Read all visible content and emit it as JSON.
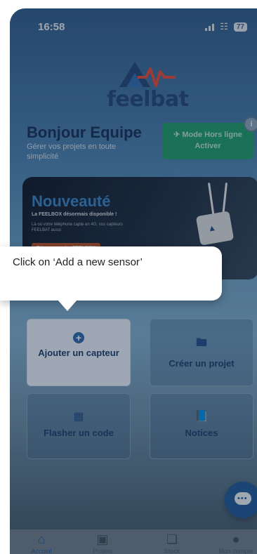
{
  "status_bar": {
    "time": "16:58",
    "battery": "77"
  },
  "logo": {
    "text": "feelbat"
  },
  "greeting": {
    "title": "Bonjour Equipe",
    "subtitle": "Gérer vos projets en toute simplicité"
  },
  "offline_button": {
    "line1": "Mode Hors ligne",
    "line2": "Activer",
    "info_icon": "i"
  },
  "banner": {
    "title": "Nouveauté",
    "line1": "La FEELBOX désormais disponible !",
    "line2": "Là où votre téléphone capte en 4G, vos capteurs FEELBAT aussi",
    "button": "Réserver votre FEELBOX"
  },
  "tooltip": {
    "text": "Click on ‘Add a new sensor’"
  },
  "tiles": [
    {
      "label": "Ajouter un capteur",
      "icon": "plus-circle-icon"
    },
    {
      "label": "Créer un projet",
      "icon": "folder-plus-icon"
    },
    {
      "label": "Flasher un code",
      "icon": "qr-scan-icon"
    },
    {
      "label": "Notices",
      "icon": "book-icon"
    }
  ],
  "tabbar": [
    {
      "label": "Accueil",
      "icon": "home-icon"
    },
    {
      "label": "Projets",
      "icon": "briefcase-icon"
    },
    {
      "label": "Stock",
      "icon": "box-icon"
    },
    {
      "label": "Mon compte",
      "icon": "user-icon"
    }
  ],
  "colors": {
    "brand": "#24497a",
    "accent": "#1f9e6c",
    "highlight_tile": "#e9f2fb"
  }
}
